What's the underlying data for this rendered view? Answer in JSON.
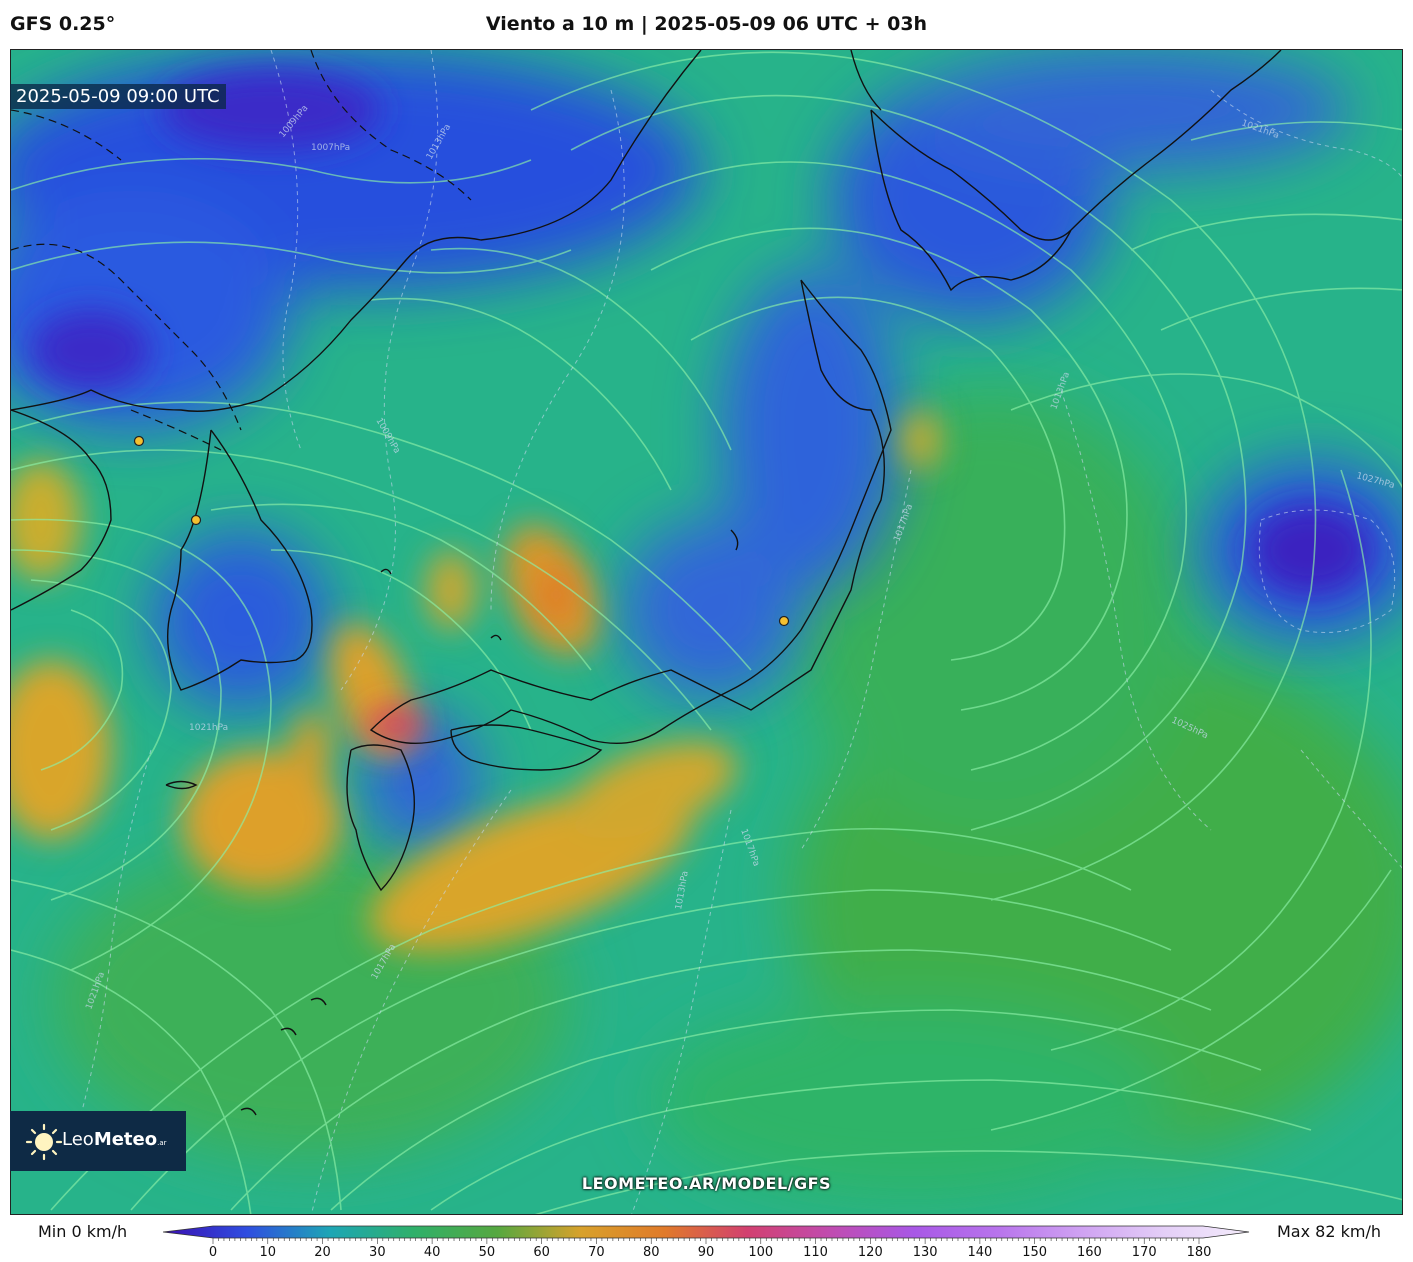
{
  "header": {
    "model_label": "GFS 0.25°",
    "title": "Viento a 10 m | 2025-05-09 06 UTC + 03h"
  },
  "map": {
    "timestamp": "2025-05-09 09:00 UTC",
    "watermark": "LEOMETEO.AR/MODEL/GFS",
    "logo": {
      "light": "Leo",
      "bold": "Meteo",
      "suffix": ".ar"
    },
    "isobar_labels": [
      "1009hPa",
      "1007hPa",
      "1013hPa",
      "1021hPa",
      "1009hPa",
      "1013hPa",
      "1027hPa",
      "1017hPa",
      "1025hPa",
      "1021hPa",
      "1017hPa",
      "1013hPa",
      "1017hPa",
      "1021hPa"
    ]
  },
  "legend": {
    "min_label": "Min 0 km/h",
    "max_label": "Max 82 km/h",
    "ticks": [
      "0",
      "10",
      "20",
      "30",
      "40",
      "50",
      "60",
      "70",
      "80",
      "90",
      "100",
      "110",
      "120",
      "130",
      "140",
      "150",
      "160",
      "170",
      "180"
    ],
    "colors": [
      "#3a0fb0",
      "#2f4de0",
      "#1ea6b5",
      "#2fb06a",
      "#56a840",
      "#d8a12b",
      "#e07a2a",
      "#d24070",
      "#c04cb0",
      "#a858e6",
      "#b874ec",
      "#cfa2f2",
      "#e4cff7",
      "#f4ecfb"
    ]
  }
}
